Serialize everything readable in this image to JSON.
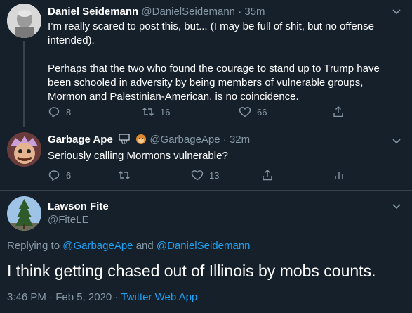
{
  "tweets": [
    {
      "name": "Daniel Seidemann",
      "handle": "@DanielSeidemann",
      "time": "· 35m",
      "text": "I’m really scared to post this, but... (I may be full of shit, but no offense intended).\n\nPerhaps that the two who found the courage to stand up to Trump have been schooled in adversity by being members of vulnerable groups, Mormon and Palestinian-American, is no coincidence.",
      "replies": "8",
      "retweets": "16",
      "likes": "66"
    },
    {
      "name": "Garbage Ape",
      "handle": "@GarbageApe",
      "time": "· 32m",
      "text": "Seriously calling Mormons vulnerable?",
      "replies": "6",
      "retweets": "",
      "likes": "13"
    }
  ],
  "main_tweet": {
    "name": "Lawson Fite",
    "handle": "@FiteLE",
    "replying_prefix": "Replying to",
    "replying_to_1": "@GarbageApe",
    "replying_and": "and",
    "replying_to_2": "@DanielSeidemann",
    "text": "I think getting chased out of Illinois by mobs counts.",
    "timestamp": "3:46 PM · Feb 5, 2020 · ",
    "source": "Twitter Web App"
  },
  "colors": {
    "background": "#15202b",
    "secondary_text": "#8899a6",
    "link": "#1da1f2",
    "divider": "#38444d"
  }
}
